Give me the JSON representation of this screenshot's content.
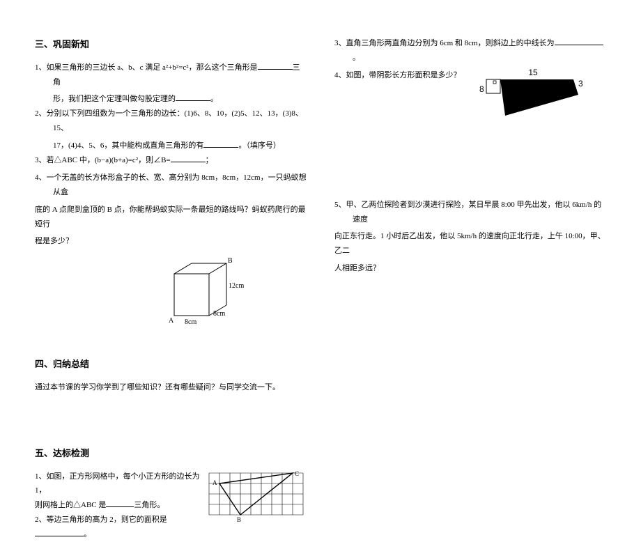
{
  "left": {
    "sec3_title": "三、巩固新知",
    "q1": "1、如果三角形的三边长 a、b、c 满足 a²+b²=c²，那么这个三角形是",
    "q1_tail": "三角",
    "q1_line2": "形，我们把这个定理叫做勾股定理的",
    "q1_period": "。",
    "q2": "2、分别以下列四组数为一个三角形的边长：(1)6、8、10，(2)5、12、13，(3)8、15、",
    "q2_line2": "17，(4)4、5、6，其中能构成直角三角形的有",
    "q2_tail": "。（填序号）",
    "q3": "3、若△ABC 中，(b−a)(b+a)=c²，则∠B=",
    "q3_tail": "；",
    "q4": "4、一个无盖的长方体形盒子的长、宽、高分别为 8cm，8cm，12cm，一只蚂蚁想从盒",
    "q4_line2": "底的 A 点爬到盒顶的 B 点，你能帮蚂蚁实际一条最短的路线吗？蚂蚁药爬行的最短行",
    "q4_line3": "程是多少？",
    "box_labels": {
      "A": "A",
      "B": "B",
      "w": "8cm",
      "d": "8cm",
      "h": "12cm"
    },
    "sec4_title": "四、归纳总结",
    "sec4_text": "通过本节课的学习你学到了哪些知识？还有哪些疑问？与同学交流一下。",
    "sec5_title": "五、达标检测",
    "q5_1a": "1、如图，正方形网格中，每个小正方形的边长为 1，",
    "q5_1b": "则网格上的△ABC 是",
    "q5_1b_tail": "三角形。",
    "q5_2": "2、等边三角形的高为 2，则它的面积是",
    "q5_2_tail": "。",
    "grid_labels": {
      "A": "A",
      "B": "B",
      "C": "C"
    }
  },
  "right": {
    "q3": "3、直角三角形两直角边分别为 6cm 和 8cm，则斜边上的中线长为",
    "q3_tail": "。",
    "q4": "4、如图，带阴影长方形面积是多少？",
    "shaded": {
      "top": "15",
      "left": "8",
      "right": "3"
    },
    "q5": "5、甲、乙两位探险者到沙漠进行探险，某日早晨 8:00 甲先出发，他以 6km/h 的速度",
    "q5_line2": "向正东行走。1 小时后乙出发，他以 5km/h 的速度向正北行走，上午 10:00，甲、乙二",
    "q5_line3": "人相距多远？"
  }
}
